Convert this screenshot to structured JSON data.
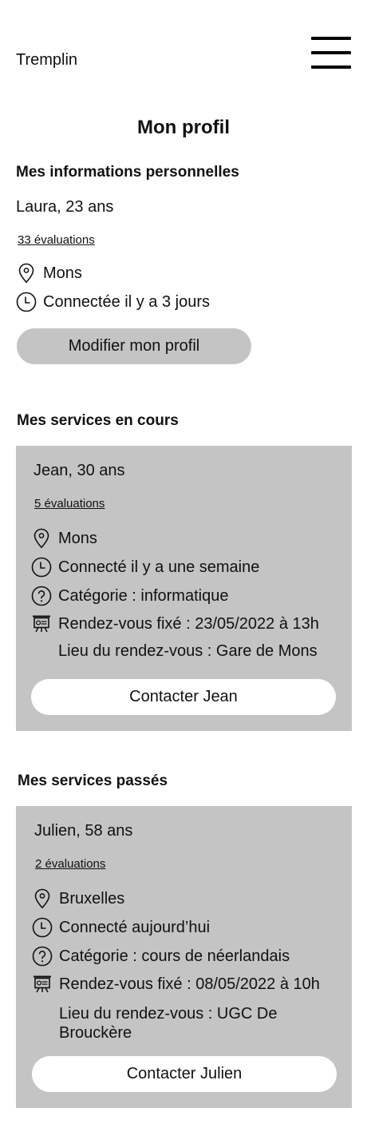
{
  "header": {
    "brand": "Tremplin",
    "menu_icon": "hamburger-icon"
  },
  "page": {
    "title": "Mon profil"
  },
  "profile": {
    "section_title": "Mes informations personnelles",
    "name": "Laura, 23 ans",
    "evaluations": "33 évaluations",
    "location": "Mons",
    "last_seen": "Connectée il y a 3 jours",
    "edit_button": "Modifier mon profil"
  },
  "current_services": {
    "section_title": "Mes services en cours",
    "card": {
      "name": "Jean, 30 ans",
      "evaluations": "5 évaluations",
      "location": "Mons",
      "last_seen": "Connecté il y a une semaine",
      "category": "Catégorie : informatique",
      "appointment": "Rendez-vous fixé : 23/05/2022 à 13h",
      "appointment_place": "Lieu du rendez-vous : Gare de Mons",
      "contact_button": "Contacter Jean"
    }
  },
  "past_services": {
    "section_title": "Mes services passés",
    "card": {
      "name": "Julien, 58 ans",
      "evaluations": "2 évaluations",
      "location": "Bruxelles",
      "last_seen": "Connecté aujourd’hui",
      "category": "Catégorie : cours de néerlandais",
      "appointment": "Rendez-vous fixé : 08/05/2022 à 10h",
      "appointment_place": "Lieu du rendez-vous : UGC De Brouckère",
      "contact_button": "Contacter Julien"
    }
  },
  "icons": {
    "location": "map-pin-icon",
    "time": "clock-icon",
    "category": "question-circle-icon",
    "appointment": "presentation-board-icon"
  }
}
